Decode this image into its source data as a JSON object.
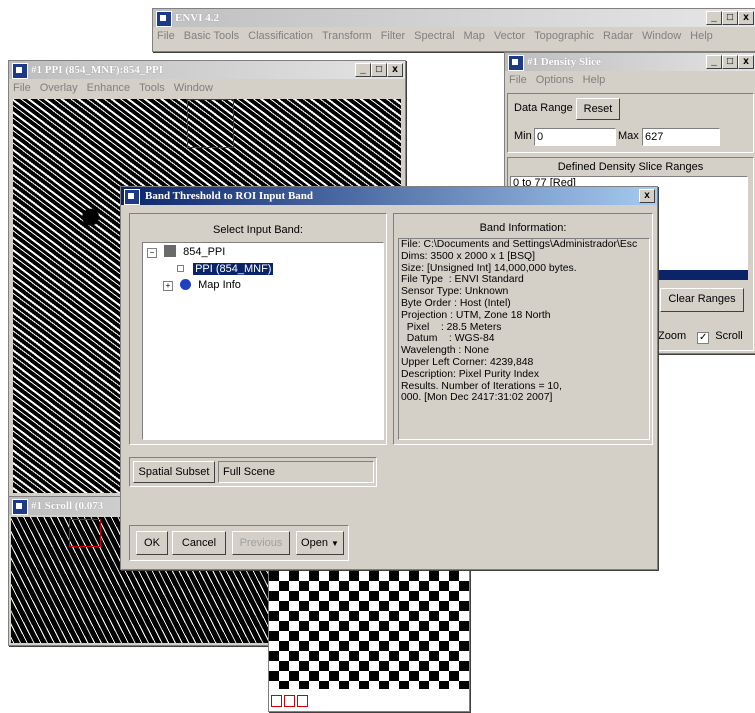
{
  "envi_main": {
    "title": "ENVI 4.2",
    "menu": [
      "File",
      "Basic Tools",
      "Classification",
      "Transform",
      "Filter",
      "Spectral",
      "Map",
      "Vector",
      "Topographic",
      "Radar",
      "Window",
      "Help"
    ]
  },
  "image_window": {
    "title": "#1 PPI (854_MNF):854_PPI",
    "menu": [
      "File",
      "Overlay",
      "Enhance",
      "Tools",
      "Window"
    ]
  },
  "scroll_window": {
    "title": "#1 Scroll (0.073"
  },
  "density_slice": {
    "title": "#1 Density Slice",
    "menu": [
      "File",
      "Options",
      "Help"
    ],
    "data_range_label": "Data Range",
    "reset_label": "Reset",
    "min_label": "Min",
    "min_value": "0",
    "max_label": "Max",
    "max_value": "627",
    "ranges_header": "Defined Density Slice Ranges",
    "ranges_first": "0 to 77 [Red]",
    "clear_label": "Clear Ranges",
    "zoom_label": "Zoom",
    "scroll_label": "Scroll"
  },
  "dialog": {
    "title": "Band Threshold to ROI Input Band",
    "select_label": "Select Input Band:",
    "tree_root": "854_PPI",
    "tree_band": "PPI (854_MNF)",
    "tree_map": "Map Info",
    "info_header": "Band Information:",
    "info_lines": [
      "File: C:\\Documents and Settings\\Administrador\\Esc",
      "Dims: 3500 x 2000 x 1 [BSQ]",
      "Size: [Unsigned Int] 14,000,000 bytes.",
      "File Type  : ENVI Standard",
      "Sensor Type: Unknown",
      "Byte Order : Host (Intel)",
      "Projection : UTM, Zone 18 North",
      "  Pixel    : 28.5 Meters",
      "  Datum    : WGS-84",
      "Wavelength : None",
      "Upper Left Corner: 4239,848",
      "Description: Pixel Purity Index",
      "Results. Number of Iterations = 10,",
      "000. [Mon Dec 2417:31:02 2007]"
    ],
    "spatial_label": "Spatial Subset",
    "spatial_value": "Full Scene",
    "ok_label": "OK",
    "cancel_label": "Cancel",
    "previous_label": "Previous",
    "open_label": "Open"
  }
}
